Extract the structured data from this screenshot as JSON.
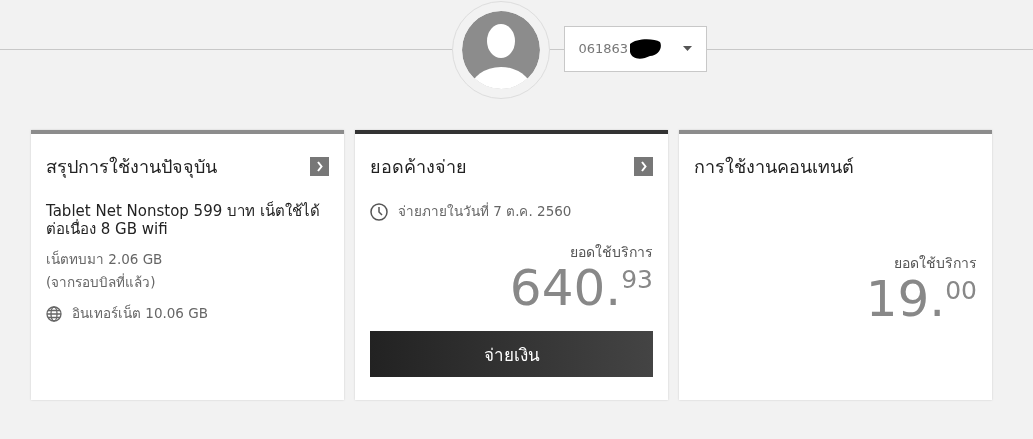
{
  "account": {
    "number": "061863",
    "redacted": true
  },
  "cards": [
    {
      "kind": "usage",
      "title": "สรุปการใช้งานปัจจุบัน",
      "selected": false,
      "has_arrow": true,
      "package": "Tablet Net Nonstop 599 บาท เน็ตใช้ได้ต่อเนื่อง 8 GB wifi",
      "carryover": "เน็ตทบมา 2.06 GB",
      "carryover_note": "(จากรอบบิลที่แล้ว)",
      "internet": "อินเทอร์เน็ต 10.06 GB"
    },
    {
      "kind": "bill",
      "title": "ยอดค้างจ่าย",
      "selected": true,
      "has_arrow": true,
      "due": "จ่ายภายในวันที่ 7 ต.ค. 2560",
      "amount_label": "ยอดใช้บริการ",
      "amount_whole": "640.",
      "amount_fraction": "93",
      "button": "จ่ายเงิน"
    },
    {
      "kind": "content",
      "title": "การใช้งานคอนเทนต์",
      "selected": false,
      "has_arrow": false,
      "amount_label": "ยอดใช้บริการ",
      "amount_whole": "19.",
      "amount_fraction": "00"
    }
  ]
}
